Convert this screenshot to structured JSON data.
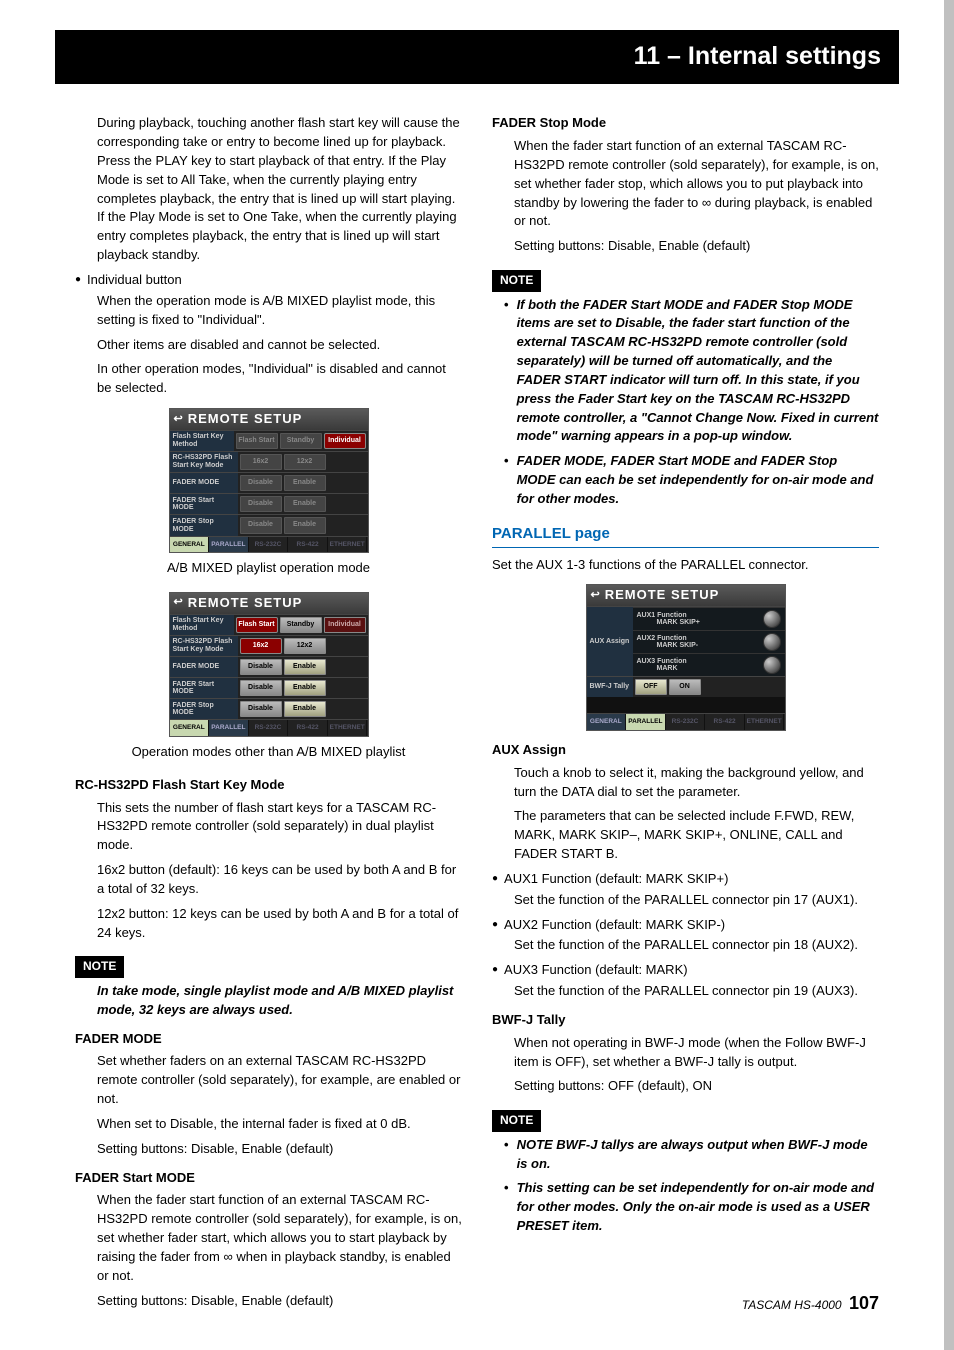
{
  "header": {
    "title": "11 – Internal settings"
  },
  "left": {
    "p1": "During playback, touching another flash start key will cause the corresponding take or entry to become lined up for playback. Press the PLAY key to start playback of that entry. If the Play Mode is set to All Take, when the currently playing entry completes playback, the entry that is lined up will start playing. If the Play Mode is set to One Take, when the currently playing entry completes playback, the entry that is lined up will start playback standby.",
    "ind_btn": "Individual button",
    "ind1": "When the operation mode is A/B MIXED playlist mode, this setting is fixed to \"Individual\".",
    "ind2": "Other items are disabled and cannot be selected.",
    "ind3": "In other operation modes, \"Individual\" is disabled and cannot be selected.",
    "cap1": "A/B MIXED playlist operation mode",
    "cap2": "Operation modes other than A/B MIXED playlist",
    "h_rc": "RC-HS32PD Flash Start Key Mode",
    "rc1": "This sets the number of flash start keys for a TASCAM RC-HS32PD remote controller (sold separately) in dual playlist mode.",
    "rc2": "16x2 button (default): 16 keys can be used by both A and B for a total of 32 keys.",
    "rc3": "12x2 button: 12 keys can be used by both A and B for a total of 24 keys.",
    "note1": "In take mode, single playlist mode and A/B MIXED playlist mode, 32 keys are always used.",
    "h_fm": "FADER MODE",
    "fm1": "Set whether faders on an external TASCAM RC-HS32PD remote controller (sold separately), for example, are enabled or not.",
    "fm2": "When set to Disable, the internal fader is fixed at 0 dB.",
    "fm3": "Setting buttons: Disable, Enable (default)",
    "h_fstart": "FADER Start MODE",
    "fstart1": "When the fader start function of an external TASCAM RC-HS32PD remote controller (sold separately), for example, is on, set whether fader start, which allows you to start playback by raising the fader from ∞ when in playback standby, is enabled or not.",
    "fstart2": "Setting buttons: Disable, Enable (default)"
  },
  "right": {
    "h_fstop": "FADER Stop Mode",
    "fstop1": "When the fader start function of an external TASCAM RC-HS32PD remote controller (sold separately), for example, is on, set whether fader stop, which allows you to put playback into standby by lowering the fader to ∞ during playback, is enabled or not.",
    "fstop2": "Setting buttons: Disable, Enable (default)",
    "note_a": "If both the FADER Start MODE and FADER Stop MODE items are set to Disable, the fader start function of the external TASCAM RC-HS32PD remote controller (sold separately) will be turned off automatically, and the FADER START indicator will turn off. In this state, if you press the Fader Start key on the TASCAM RC-HS32PD remote controller, a \"Cannot Change Now. Fixed in current mode\" warning appears in a pop-up window.",
    "note_b": "FADER MODE, FADER Start MODE and FADER Stop MODE can each be set independently for on-air mode and for other modes.",
    "h_par": "PARALLEL page",
    "par1": "Set the AUX 1-3 functions of the PARALLEL connector.",
    "h_aux": "AUX Assign",
    "aux1": "Touch a knob to select it, making the background yellow, and turn the DATA dial to set the parameter.",
    "aux2": "The parameters that can be selected include F.FWD, REW, MARK, MARK SKIP–, MARK SKIP+, ONLINE, CALL and FADER START B.",
    "aux_b1_h": "AUX1 Function (default: MARK SKIP+)",
    "aux_b1_t": "Set the function of the PARALLEL connector pin 17 (AUX1).",
    "aux_b2_h": "AUX2 Function (default: MARK SKIP-)",
    "aux_b2_t": "Set the function of the PARALLEL connector pin 18 (AUX2).",
    "aux_b3_h": "AUX3 Function (default: MARK)",
    "aux_b3_t": "Set the function of the PARALLEL connector pin 19 (AUX3).",
    "h_bwf": "BWF-J Tally",
    "bwf1": "When not operating in BWF-J mode (when the Follow BWF-J item is OFF), set whether a BWF-J tally is output.",
    "bwf2": "Setting buttons: OFF (default), ON",
    "note_c": "NOTE BWF-J tallys are always output when BWF-J mode is on.",
    "note_d": "This setting can be set independently for on-air mode and for other modes. Only the on-air mode is used as a USER PRESET item."
  },
  "panel": {
    "title": "REMOTE SETUP",
    "r1_label": "Flash Start\nKey Method",
    "r1_b1": "Flash\nStart",
    "r1_b2": "Standby",
    "r1_b3": "Individual",
    "r2_label": "RC-HS32PD\nFlash Start\nKey Mode",
    "r2_b1": "16x2",
    "r2_b2": "12x2",
    "r3_label": "FADER MODE",
    "r3_b1": "Disable",
    "r3_b2": "Enable",
    "r4_label": "FADER Start\nMODE",
    "r4_b1": "Disable",
    "r4_b2": "Enable",
    "r5_label": "FADER Stop\nMODE",
    "r5_b1": "Disable",
    "r5_b2": "Enable",
    "t1": "GENERAL",
    "t2": "PARALLEL",
    "t3": "RS-232C",
    "t4": "RS-422",
    "t5": "ETHERNET"
  },
  "panel3": {
    "lab_aux": "AUX\nAssign",
    "f1a": "AUX1 Function",
    "f1b": "MARK SKIP+",
    "f2a": "AUX2 Function",
    "f2b": "MARK SKIP-",
    "f3a": "AUX3 Function",
    "f3b": "MARK",
    "lab_bwf": "BWF-J\nTally",
    "off": "OFF",
    "on": "ON"
  },
  "footer": {
    "brand": "TASCAM HS-4000",
    "page": "107"
  },
  "note_label": "NOTE"
}
